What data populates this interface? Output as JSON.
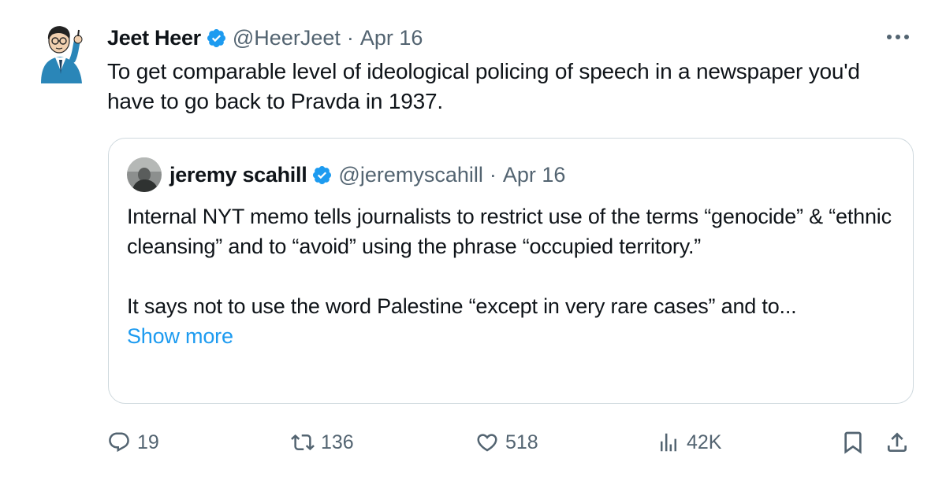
{
  "tweet": {
    "author_name": "Jeet Heer",
    "handle": "@HeerJeet",
    "separator": "·",
    "date": "Apr 16",
    "text": "To get comparable level of ideological policing of speech in a newspaper you'd have to go back to Pravda in 1937."
  },
  "quote": {
    "author_name": "jeremy scahill",
    "handle": "@jeremyscahill",
    "separator": "·",
    "date": "Apr 16",
    "paragraph1": "Internal NYT memo tells journalists to restrict use of the terms “genocide” & “ethnic cleansing” and to “avoid” using the phrase “occupied territory.”",
    "paragraph2": "It says not to use the word Palestine “except in very rare cases” and to...",
    "show_more": "Show more"
  },
  "actions": {
    "replies": "19",
    "reposts": "136",
    "likes": "518",
    "views": "42K"
  },
  "colors": {
    "verified": "#1d9bf0",
    "muted": "#536471",
    "link": "#1d9bf0",
    "border": "#cfd9de"
  },
  "icons": [
    "more-icon",
    "verified-badge-icon",
    "reply-icon",
    "repost-icon",
    "like-icon",
    "views-icon",
    "bookmark-icon",
    "share-icon"
  ]
}
